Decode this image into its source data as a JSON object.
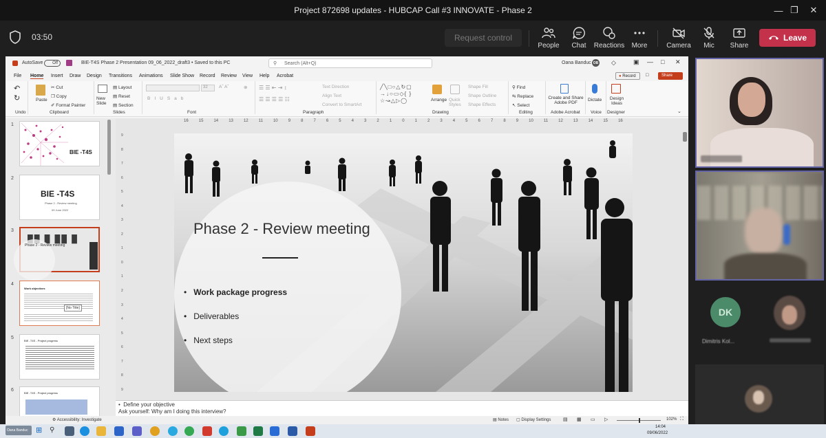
{
  "window": {
    "title": "Project 872698 updates - HUBCAP Call #3 INNOVATE - Phase 2"
  },
  "meeting": {
    "timer": "03:50",
    "request_control": "Request control",
    "people": "People",
    "chat": "Chat",
    "reactions": "Reactions",
    "more": "More",
    "camera": "Camera",
    "mic": "Mic",
    "share": "Share",
    "leave": "Leave"
  },
  "ppt": {
    "autosave": "AutoSave",
    "autosave_state": "Off",
    "doc_title": "BIE-T4S Phase 2 Presentation 09_06_2022_draft3 • Saved to this PC",
    "search_placeholder": "Search (Alt+Q)",
    "user": "Oana Banduc",
    "user_initials": "OB",
    "record": "Record",
    "share": "Share",
    "menu": [
      "File",
      "Home",
      "Insert",
      "Draw",
      "Design",
      "Transitions",
      "Animations",
      "Slide Show",
      "Record",
      "Review",
      "View",
      "Help",
      "Acrobat"
    ],
    "ribbon": {
      "undo": "Undo",
      "paste": "Paste",
      "cut": "Cut",
      "copy": "Copy",
      "format_painter": "Format Painter",
      "clipboard": "Clipboard",
      "new_slide": "New Slide",
      "layout": "Layout",
      "reset": "Reset",
      "section": "Section",
      "slides": "Slides",
      "font": "Font",
      "font_size": "32",
      "text_direction": "Text Direction",
      "align_text": "Align Text",
      "convert_smartart": "Convert to SmartArt",
      "paragraph": "Paragraph",
      "arrange": "Arrange",
      "quick_styles": "Quick Styles",
      "shape_fill": "Shape Fill",
      "shape_outline": "Shape Outline",
      "shape_effects": "Shape Effects",
      "drawing": "Drawing",
      "find": "Find",
      "replace": "Replace",
      "select": "Select",
      "editing": "Editing",
      "create_share_pdf": "Create and Share Adobe PDF",
      "adobe_acrobat": "Adobe Acrobat",
      "dictate": "Dictate",
      "voice": "Voice",
      "design_ideas": "Design Ideas",
      "designer": "Designer"
    },
    "ruler_ticks": [
      "16",
      "15",
      "14",
      "13",
      "12",
      "11",
      "10",
      "9",
      "8",
      "7",
      "6",
      "5",
      "4",
      "3",
      "2",
      "1",
      "0",
      "1",
      "2",
      "3",
      "4",
      "5",
      "6",
      "7",
      "8",
      "9",
      "10",
      "11",
      "12",
      "13",
      "14",
      "15",
      "16"
    ],
    "thumbnails": [
      {
        "num": "1",
        "title": "BIE -T4S"
      },
      {
        "num": "2",
        "title": "BIE -T4S",
        "sub1": "Phase 2 - Review meeting",
        "sub2": "09 June 2022"
      },
      {
        "num": "3",
        "title": "Phase 2 - Review meeting"
      },
      {
        "num": "4",
        "title": "Work objectives",
        "tooltip": "[No Title]"
      },
      {
        "num": "5",
        "title": "BIE -T4S - Project progress"
      },
      {
        "num": "6",
        "title": "BIE -T4S - Project progress"
      }
    ],
    "slide": {
      "title": "Phase 2 -  Review meeting",
      "bullets": [
        "Work package progress",
        "Deliverables",
        "Next steps"
      ]
    },
    "notes": {
      "line1": "Define your objective",
      "line2": "Ask yourself: Why am I doing this interview?"
    },
    "status": {
      "accessibility": "Accessibility: Investigate",
      "notes": "Notes",
      "display_settings": "Display Settings",
      "zoom": "102%"
    }
  },
  "taskbar": {
    "user_chip": "Oana Banduc",
    "time": "14:04",
    "date": "09/06/2022"
  },
  "participants": [
    {
      "initials": "DK",
      "name": "Dimitris Kol..."
    }
  ],
  "colors": {
    "leave": "#c4314b",
    "ppt_accent": "#c43e1c",
    "dk_avatar": "#4b8b6a"
  }
}
